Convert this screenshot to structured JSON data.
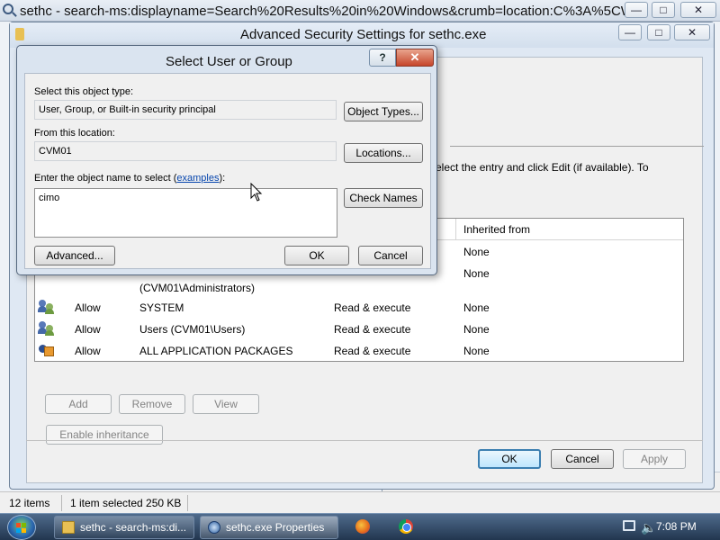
{
  "explorer": {
    "title": "sethc - search-ms:displayname=Search%20Results%20in%20Windows&crumb=location:C%3A%5CWi...",
    "status_items": "12 items",
    "status_selected": "1 item selected  250 KB"
  },
  "advanced_security": {
    "title": "Advanced Security Settings for sethc.exe",
    "instruction": "elect the entry and click Edit (if available). To",
    "table": {
      "header_inherited": "Inherited from",
      "rows": [
        {
          "type": "",
          "principal": "",
          "access": "",
          "inherited": "None"
        },
        {
          "type": "",
          "principal": "",
          "access": "",
          "inherited": "None"
        },
        {
          "type": "",
          "principal": "(CVM01\\Administrators)",
          "access": "",
          "inherited": ""
        },
        {
          "type": "Allow",
          "principal": "SYSTEM",
          "access": "Read & execute",
          "inherited": "None"
        },
        {
          "type": "Allow",
          "principal": "Users (CVM01\\Users)",
          "access": "Read & execute",
          "inherited": "None"
        },
        {
          "type": "Allow",
          "principal": "ALL APPLICATION PACKAGES",
          "access": "Read & execute",
          "inherited": "None"
        }
      ]
    },
    "buttons": {
      "add": "Add",
      "remove": "Remove",
      "view": "View",
      "enable_inheritance": "Enable inheritance",
      "ok": "OK",
      "cancel": "Cancel",
      "apply": "Apply"
    }
  },
  "select_dialog": {
    "title": "Select User or Group",
    "help": "?",
    "close": "✕",
    "object_type_label": "Select this object type:",
    "object_type_value": "User, Group, or Built-in security principal",
    "object_types_button": "Object Types...",
    "location_label": "From this location:",
    "location_value": "CVM01",
    "locations_button": "Locations...",
    "enter_name_label_prefix": "Enter the object name to select (",
    "examples_link": "examples",
    "enter_name_label_suffix": "):",
    "object_name_value": "cimo",
    "check_names_button": "Check Names",
    "advanced_button": "Advanced...",
    "ok_button": "OK",
    "cancel_button": "Cancel"
  },
  "taskbar": {
    "tasks": [
      {
        "label": "sethc - search-ms:di..."
      },
      {
        "label": "sethc.exe Properties"
      }
    ],
    "clock": "7:08 PM"
  },
  "colors": {
    "link": "#0645ad",
    "default_button_border": "#3c7fb1",
    "close_button": "#c6452b",
    "taskbar": "#22364f"
  }
}
